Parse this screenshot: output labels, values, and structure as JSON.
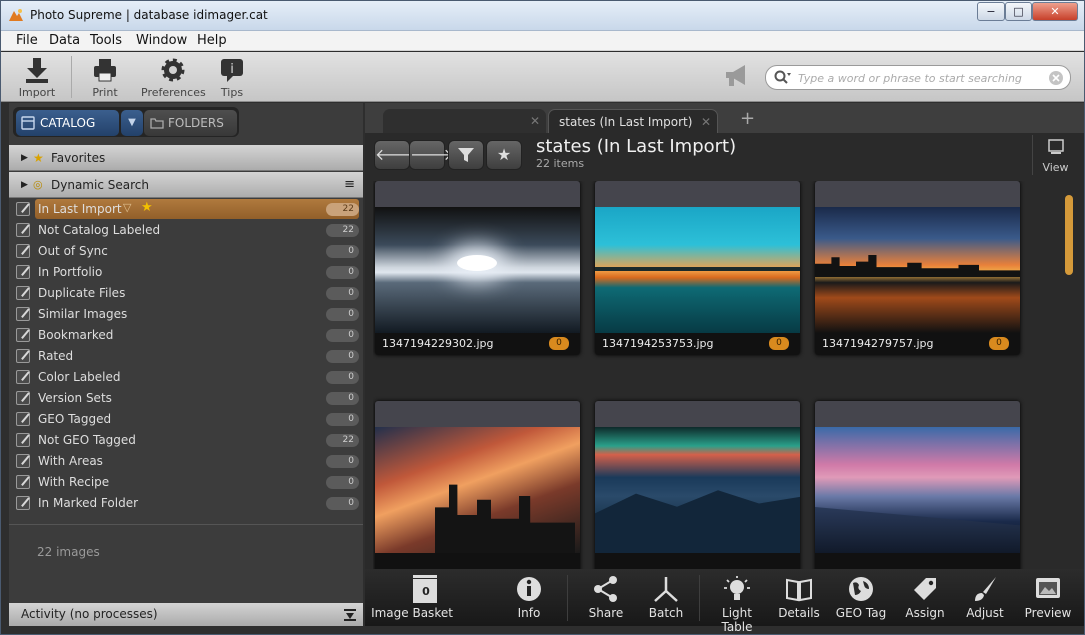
{
  "window": {
    "title": "Photo Supreme | database idimager.cat",
    "minimize": "−",
    "maximize": "□",
    "close": "✕"
  },
  "menu": [
    "File",
    "Data",
    "Tools",
    "Window",
    "Help"
  ],
  "toolbar": {
    "buttons": [
      {
        "label": "Import",
        "icon": "import-icon"
      },
      {
        "label": "Print",
        "icon": "print-icon"
      },
      {
        "label": "Preferences",
        "icon": "gear-icon"
      },
      {
        "label": "Tips",
        "icon": "tips-icon"
      }
    ],
    "search_placeholder": "Type a word or phrase to start searching",
    "search_value": ""
  },
  "left_panel": {
    "tabs": {
      "catalog": "CATALOG",
      "folders": "FOLDERS",
      "dropdown": "▼"
    },
    "favorites": "Favorites",
    "dynamic_search": "Dynamic Search",
    "items": [
      {
        "label": "In Last Import",
        "count": "22",
        "selected": true
      },
      {
        "label": "Not Catalog Labeled",
        "count": "22"
      },
      {
        "label": "Out of Sync",
        "count": "0"
      },
      {
        "label": "In Portfolio",
        "count": "0"
      },
      {
        "label": "Duplicate Files",
        "count": "0"
      },
      {
        "label": "Similar Images",
        "count": "0"
      },
      {
        "label": "Bookmarked",
        "count": "0"
      },
      {
        "label": "Rated",
        "count": "0"
      },
      {
        "label": "Color Labeled",
        "count": "0"
      },
      {
        "label": "Version Sets",
        "count": "0"
      },
      {
        "label": "GEO Tagged",
        "count": "0"
      },
      {
        "label": "Not GEO Tagged",
        "count": "22"
      },
      {
        "label": "With Areas",
        "count": "0"
      },
      {
        "label": "With Recipe",
        "count": "0"
      },
      {
        "label": "In Marked Folder",
        "count": "0"
      }
    ],
    "count_text": "22 images",
    "activity": "Activity (no processes)"
  },
  "right_panel": {
    "tab_active": "states (In Last Import)",
    "title": "states (In Last Import)",
    "subtitle": "22 items",
    "view_label": "View",
    "thumbnails": [
      {
        "filename": "1347194229302.jpg",
        "rating": "0"
      },
      {
        "filename": "1347194253753.jpg",
        "rating": "0"
      },
      {
        "filename": "1347194279757.jpg",
        "rating": "0"
      },
      {
        "filename": "",
        "rating": ""
      },
      {
        "filename": "",
        "rating": ""
      },
      {
        "filename": "",
        "rating": ""
      }
    ],
    "basket_count": "0",
    "bottom_buttons": [
      "Image Basket",
      "Info",
      "Share",
      "Batch",
      "Light Table",
      "Details",
      "GEO Tag",
      "Assign",
      "Adjust",
      "Preview"
    ]
  },
  "colors": {
    "accent_orange": "#d98a1e",
    "catalog_blue": "#2c4f7c",
    "selected_item": "#a06b32"
  }
}
